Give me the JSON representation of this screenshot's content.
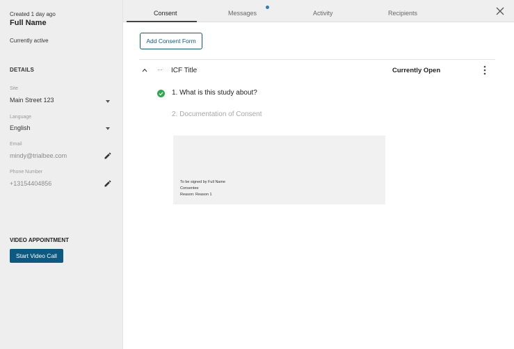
{
  "sidebar": {
    "created": "Created 1 day ago",
    "full_name": "Full Name",
    "status": "Currently active",
    "details_heading": "DETAILS",
    "site": {
      "label": "Site",
      "value": "Main Street 123"
    },
    "language": {
      "label": "Language",
      "value": "English"
    },
    "email": {
      "label": "Email",
      "value": "mindy@trialbee.com"
    },
    "phone": {
      "label": "Phone Number",
      "value": "+13154404856"
    },
    "video_heading": "VIDEO APPOINTMENT",
    "video_button": "Start Video Call"
  },
  "tabs": [
    {
      "label": "Consent",
      "active": true
    },
    {
      "label": "Messages",
      "unread_indicator": true
    },
    {
      "label": "Activity"
    },
    {
      "label": "Recipients"
    }
  ],
  "main": {
    "add_button": "Add Consent Form",
    "form": {
      "title": "ICF Title",
      "status": "Currently Open",
      "steps": [
        {
          "label": "1. What is this study about?",
          "completed": true
        },
        {
          "label": "2. Documentation of Consent",
          "completed": false
        }
      ],
      "signature": {
        "line1": "To be signed by Full Name",
        "line2": "Consentee",
        "line3": "Reason: Reason 1"
      }
    }
  },
  "colors": {
    "primary": "#0c5a82",
    "success": "#2fa84f",
    "indicator": "#2f7fb5",
    "sidebar_bg": "#eeeeee"
  }
}
